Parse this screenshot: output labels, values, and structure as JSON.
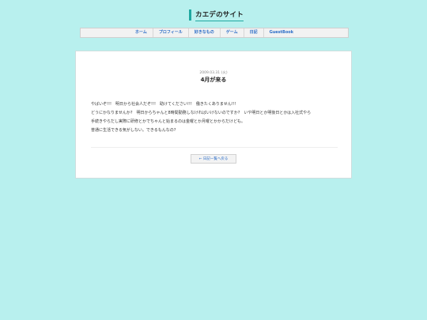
{
  "header": {
    "site_title": "カエデのサイト"
  },
  "nav": {
    "items": [
      {
        "label": "ホーム"
      },
      {
        "label": "プロフィール"
      },
      {
        "label": "好きなもの"
      },
      {
        "label": "ゲーム"
      },
      {
        "label": "日記"
      },
      {
        "label": "GuestBook"
      }
    ]
  },
  "post": {
    "date": "2009.03.31 (火)",
    "title": "4月が来る",
    "lines": [
      "やばいぞ!!!　明日から社会人だぞ!!!　助けてください!!!　働きたくありません!!!",
      "どうにかなりませんか?　明日からちゃんと8時間勤務しなければいけないのですか?　いや明日とか明後日とかは入社式やら",
      "手続きやらだし実際に研修とかでちゃんと始まるのは金曜とか月曜とかからだけども。",
      "普通に生活できる気がしない。できるもんなの?"
    ],
    "back_label": "← 日記一覧へ戻る"
  },
  "colors": {
    "background": "#b8f0ee",
    "accent": "#1fa8a0",
    "link": "#2a6cc7"
  }
}
